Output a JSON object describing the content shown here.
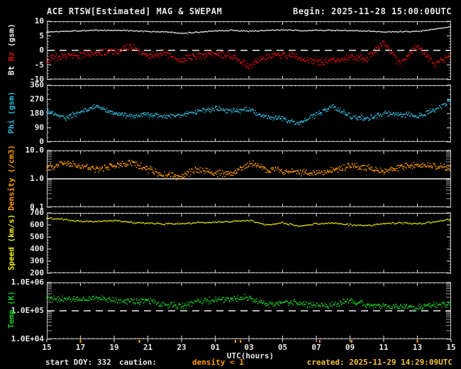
{
  "header": {
    "title": "ACE RTSW[Estimated] MAG & SWEPAM",
    "begin": "Begin: 2025-11-28 15:00:00UTC"
  },
  "footer": {
    "start_doy": "start DOY: 332",
    "caution_label": "caution:",
    "caution_value": "density < 1",
    "created": "created: 2025-11-29 14:29:09UTC"
  },
  "colors": {
    "background": "#000000",
    "axis": "#c8c8c8",
    "bt": "#f0f0f0",
    "bz": "#dd1111",
    "phi": "#2fb8d8",
    "density": "#ff9a00",
    "speed": "#f0f000",
    "temp": "#19c823",
    "caution_mark": "#ff9a00",
    "created_text": "#f0c23c"
  },
  "chart_data": {
    "type": "scatter",
    "title": "ACE RTSW[Estimated] MAG & SWEPAM",
    "x_axis": {
      "label": "UTC(hours)",
      "start": "2025-11-28 15:00UTC",
      "hours_span": 24,
      "tick_interval_hours": 2,
      "tick_labels": [
        "15",
        "17",
        "19",
        "21",
        "23",
        "01",
        "03",
        "05",
        "07",
        "09",
        "11",
        "13",
        "15"
      ]
    },
    "caution_marks_hours": [
      2.0,
      5.5,
      11.2,
      11.5,
      16.2,
      18.1,
      22.0
    ],
    "panels": [
      {
        "name": "bt-bz",
        "top": 30,
        "height": 82,
        "scale": "linear",
        "ylim": [
          -10,
          10
        ],
        "ylabel_parts": [
          {
            "text": "Bt ",
            "color": "#f0f0f0"
          },
          {
            "text": "Bz ",
            "color": "#dd1111"
          },
          {
            "text": "(gsm)",
            "color": "#f0f0f0"
          }
        ],
        "yticks": [
          {
            "v": 10,
            "label": "10"
          },
          {
            "v": 5,
            "label": "5"
          },
          {
            "v": 0,
            "label": "0"
          },
          {
            "v": -5,
            "label": "-5"
          },
          {
            "v": -10,
            "label": "-10"
          }
        ],
        "yminor_step": 1,
        "reflines": [
          {
            "v": 0,
            "style": "dashed",
            "color": "#f0f0f0"
          }
        ],
        "series": [
          {
            "name": "Bt",
            "color": "#f0f0f0",
            "jitter": 0.25,
            "dots_per_step": 1,
            "values_hourly": [
              6.3,
              6.6,
              6.8,
              6.9,
              6.9,
              6.8,
              6.5,
              6.4,
              5.8,
              6.3,
              6.7,
              6.9,
              6.6,
              6.9,
              7.0,
              6.8,
              6.9,
              6.9,
              6.8,
              6.6,
              6.4,
              6.4,
              6.6,
              7.2,
              8.1
            ]
          },
          {
            "name": "Bz",
            "color": "#dd1111",
            "jitter": 1.5,
            "dots_per_step": 2,
            "values_hourly": [
              -3,
              -2,
              -1.5,
              -1,
              -0.5,
              1.5,
              -2,
              -1,
              -3.5,
              -2,
              -1,
              -2,
              -5.5,
              -2,
              -1.5,
              -2.5,
              -4,
              -3.5,
              -2.5,
              -3,
              2.5,
              -4.5,
              1.5,
              -4.5,
              -2
            ]
          }
        ]
      },
      {
        "name": "phi",
        "top": 120,
        "height": 80,
        "scale": "linear",
        "ylim": [
          0,
          360
        ],
        "ylabel_parts": [
          {
            "text": "Phi (gsm)",
            "color": "#2fb8d8"
          }
        ],
        "yticks": [
          {
            "v": 360,
            "label": "360"
          },
          {
            "v": 270,
            "label": "270"
          },
          {
            "v": 180,
            "label": "180"
          },
          {
            "v": 90,
            "label": "90"
          },
          {
            "v": 0,
            "label": "0"
          }
        ],
        "yminor_step": 30,
        "reflines": [],
        "series": [
          {
            "name": "Phi",
            "color": "#2fb8d8",
            "jitter": 20,
            "dots_per_step": 2,
            "values_hourly": [
              200,
              150,
              185,
              230,
              180,
              165,
              175,
              160,
              170,
              195,
              210,
              195,
              205,
              160,
              145,
              120,
              170,
              230,
              165,
              150,
              180,
              175,
              165,
              200,
              265
            ]
          }
        ]
      },
      {
        "name": "density",
        "top": 212,
        "height": 80,
        "scale": "log",
        "ylim": [
          0.1,
          10
        ],
        "ylabel_parts": [
          {
            "text": "Density (/cm3)",
            "color": "#ff9a00"
          }
        ],
        "yticks": [
          {
            "v": 10,
            "label": "10.0"
          },
          {
            "v": 1,
            "label": "1.0"
          },
          {
            "v": 0.1,
            "label": "0.1"
          }
        ],
        "yminor_log": true,
        "reflines": [
          {
            "v": 1,
            "style": "solid",
            "color": "#f0f0f0"
          }
        ],
        "series": [
          {
            "name": "Density",
            "color": "#ff9a00",
            "jitter": 0.14,
            "dots_per_step": 2,
            "values_hourly": [
              2.5,
              3.5,
              2.8,
              2.2,
              3.0,
              3.8,
              2.2,
              1.3,
              1.2,
              2.2,
              1.6,
              1.5,
              3.5,
              2.2,
              1.8,
              1.7,
              1.6,
              2.0,
              2.8,
              2.4,
              1.8,
              2.6,
              3.2,
              2.8,
              2.4
            ]
          }
        ]
      },
      {
        "name": "speed",
        "top": 300,
        "height": 85,
        "scale": "linear",
        "ylim": [
          200,
          700
        ],
        "ylabel_parts": [
          {
            "text": "Speed (km/s)",
            "color": "#f0f000"
          }
        ],
        "yticks": [
          {
            "v": 700,
            "label": "700"
          },
          {
            "v": 600,
            "label": "600"
          },
          {
            "v": 500,
            "label": "500"
          },
          {
            "v": 400,
            "label": "400"
          },
          {
            "v": 300,
            "label": "300"
          },
          {
            "v": 200,
            "label": "200"
          }
        ],
        "yminor_step": 25,
        "reflines": [],
        "series": [
          {
            "name": "Speed",
            "color": "#f0f000",
            "jitter": 9,
            "dots_per_step": 1,
            "values_hourly": [
              655,
              645,
              630,
              628,
              635,
              622,
              612,
              608,
              612,
              618,
              622,
              628,
              638,
              600,
              618,
              592,
              610,
              615,
              600,
              595,
              612,
              618,
              608,
              625,
              648
            ]
          }
        ]
      },
      {
        "name": "temp",
        "top": 398,
        "height": 80,
        "scale": "log",
        "ylim": [
          10000,
          1000000
        ],
        "ylabel_parts": [
          {
            "text": "Temp (K)",
            "color": "#19c823"
          }
        ],
        "yticks": [
          {
            "v": 1000000,
            "label": "1.0E+06"
          },
          {
            "v": 100000,
            "label": "1.0E+05"
          },
          {
            "v": 10000,
            "label": "1.0E+04"
          }
        ],
        "yminor_log": true,
        "reflines": [
          {
            "v": 100000,
            "style": "dashed",
            "color": "#f0f0f0"
          }
        ],
        "series": [
          {
            "name": "Temp",
            "color": "#19c823",
            "jitter": 0.13,
            "dots_per_step": 2,
            "values_hourly": [
              280000,
              260000,
              240000,
              270000,
              230000,
              210000,
              240000,
              160000,
              150000,
              220000,
              240000,
              260000,
              300000,
              170000,
              200000,
              190000,
              150000,
              160000,
              240000,
              160000,
              150000,
              140000,
              130000,
              160000,
              180000
            ]
          }
        ]
      }
    ]
  }
}
